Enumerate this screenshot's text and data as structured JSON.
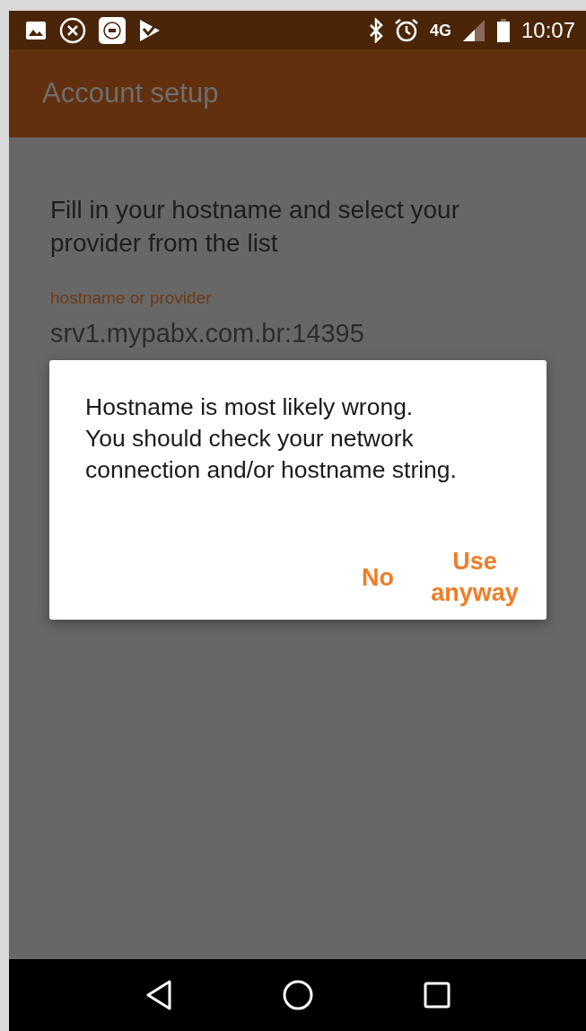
{
  "status_bar": {
    "network": "4G",
    "time": "10:07"
  },
  "app_bar": {
    "title": "Account setup"
  },
  "content": {
    "instruction": "Fill in your hostname and select your provider from the list",
    "field": {
      "label": "hostname or provider",
      "value": "srv1.mypabx.com.br:14395"
    }
  },
  "dialog": {
    "message": "Hostname is most likely wrong.\nYou should check your network connection and/or hostname string.",
    "buttons": [
      "No",
      "Use anyway"
    ]
  }
}
